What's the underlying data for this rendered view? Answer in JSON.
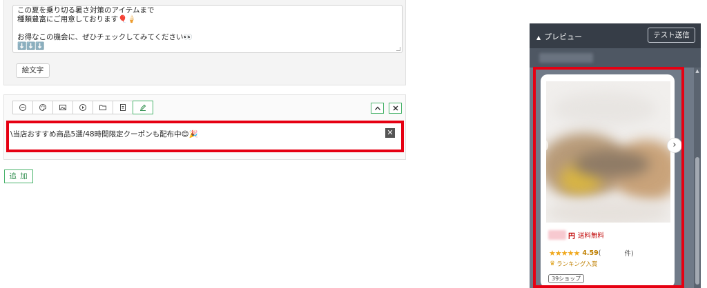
{
  "message_editor": {
    "lines": [
      "この夏を乗り切る暑さ対策のアイテムまで",
      "種類豊富にご用意しております🎈🍦",
      "",
      "お得なこの機会に、ぜひチェックしてみてください👀",
      "⬇️⬇️⬇️"
    ],
    "emoji_button": "絵文字"
  },
  "card_editor": {
    "toolbar_icons": [
      "minus-circle-icon",
      "palette-icon",
      "image-icon",
      "play-icon",
      "folder-icon",
      "list-icon",
      "pencil-icon"
    ],
    "text_value": "\\当店おすすめ商品5選/48時間限定クーポンも配布中😊🎉",
    "clear_symbol": "✕"
  },
  "add_button": "追 加",
  "preview": {
    "title": "プレビュー",
    "collapse_symbol": "▲",
    "test_send_button": "テスト送信",
    "scroll_up_symbol": "▲",
    "next_symbol": "›",
    "product": {
      "yen": "円",
      "shipping": "送料無料",
      "stars": "★★★★★",
      "rating": "4.59",
      "review_open": "(",
      "review_unit": "件)",
      "crown_symbol": "♛",
      "rank_label": "ランキング入賞",
      "shop_badge": "39ショップ"
    }
  },
  "colors": {
    "highlight": "#e60012",
    "accent_green": "#49b36b",
    "price_red": "#bf0000",
    "star": "#f0a81c"
  }
}
